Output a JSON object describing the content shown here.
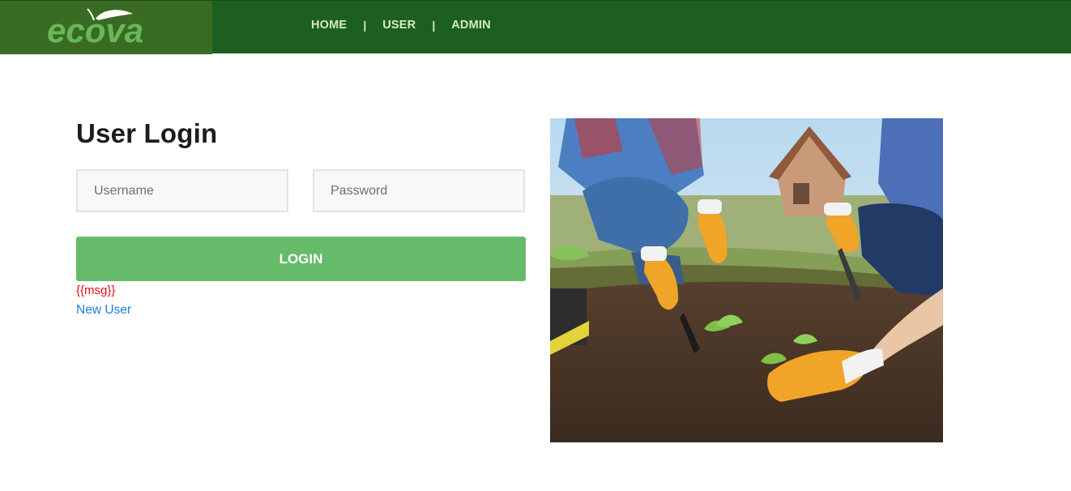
{
  "brand": {
    "name": "ecova",
    "logo_color": "#67b85a",
    "leaf_color": "#ffffff"
  },
  "nav": {
    "items": [
      "HOME",
      "USER",
      "ADMIN"
    ],
    "separator": "|"
  },
  "login": {
    "title": "User Login",
    "username_placeholder": "Username",
    "password_placeholder": "Password",
    "button_label": "LOGIN",
    "message": "{{msg}}",
    "new_user_label": "New User"
  },
  "colors": {
    "navbar": "#1d5f20",
    "logo_box": "#3a6b22",
    "button": "#66bb6a",
    "message": "#e01010",
    "link": "#1a7fd6"
  }
}
